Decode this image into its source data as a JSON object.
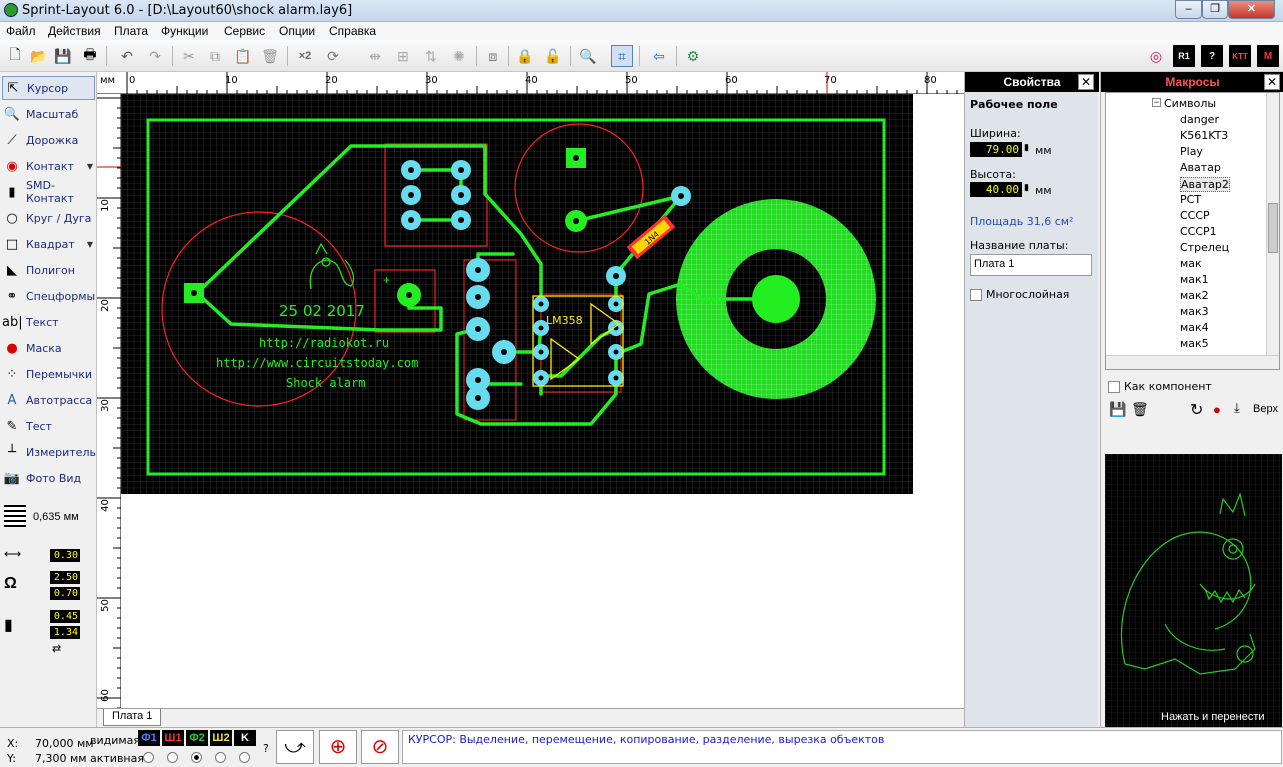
{
  "window": {
    "title": "Sprint-Layout 6.0 - [D:\\Layout60\\shock alarm.lay6]",
    "min": "–",
    "max": "❐",
    "close": "✕"
  },
  "menu": [
    "Файл",
    "Действия",
    "Плата",
    "Функции",
    "Сервис",
    "Опции",
    "Справка"
  ],
  "tools": [
    {
      "label": "Курсор",
      "icon": "cursor-icon",
      "glyph": "⇱"
    },
    {
      "label": "Масштаб",
      "icon": "zoom-icon",
      "glyph": "🔍"
    },
    {
      "label": "Дорожка",
      "icon": "track-icon",
      "glyph": "⟋"
    },
    {
      "label": "Контакт",
      "icon": "pad-icon",
      "glyph": "◉"
    },
    {
      "label": "SMD-Контакт",
      "icon": "smd-icon",
      "glyph": "▮"
    },
    {
      "label": "Круг / Дуга",
      "icon": "circle-icon",
      "glyph": "○"
    },
    {
      "label": "Квадрат",
      "icon": "square-icon",
      "glyph": "□"
    },
    {
      "label": "Полигон",
      "icon": "polygon-icon",
      "glyph": "◣"
    },
    {
      "label": "Спецформы",
      "icon": "special-shapes-icon",
      "glyph": "⚭"
    },
    {
      "label": "Текст",
      "icon": "text-icon",
      "glyph": "ab|"
    },
    {
      "label": "Маска",
      "icon": "mask-icon",
      "glyph": "●"
    },
    {
      "label": "Перемычки",
      "icon": "jumper-icon",
      "glyph": "⁘"
    },
    {
      "label": "Автотрасса",
      "icon": "autoroute-icon",
      "glyph": "A"
    },
    {
      "label": "Тест",
      "icon": "test-icon",
      "glyph": "✎"
    },
    {
      "label": "Измеритель",
      "icon": "measure-icon",
      "glyph": "┴"
    },
    {
      "label": "Фото Вид",
      "icon": "photo-view-icon",
      "glyph": "📷"
    }
  ],
  "grid": {
    "value": "0,635 мм"
  },
  "params": {
    "track_width": "0.30",
    "pad_outer": "2.50",
    "pad_inner": "0.70",
    "smd_w": "0.45",
    "smd_h": "1.34"
  },
  "ruler": {
    "unit": "мм",
    "top": [
      "0",
      "10",
      "20",
      "30",
      "40",
      "50",
      "60",
      "70",
      "80"
    ],
    "left": [
      "10",
      "20",
      "30",
      "40",
      "50",
      "60"
    ]
  },
  "board": {
    "date": "25 02 2017",
    "line1": "http://radiokot.ru",
    "line2": "http://www.circuitstoday.com",
    "line3": "Shock alarm",
    "ic": "LM358",
    "diode": "1N4"
  },
  "tab": "Плата 1",
  "properties": {
    "title": "Свойства",
    "section": "Рабочее поле",
    "width_label": "Ширина:",
    "width": "79.00",
    "unit": "мм",
    "height_label": "Высота:",
    "height": "40.00",
    "area": "Площадь   31,6 см²",
    "name_label": "Название платы:",
    "name": "Плата 1",
    "multilayer": "Многослойная"
  },
  "macros": {
    "title": "Макросы",
    "folder": "Символы",
    "items": [
      "danger",
      "K561KT3",
      "Play",
      "Аватар",
      "Аватар2",
      "PCT",
      "CCCP",
      "CCCP1",
      "Стрелец",
      "мак",
      "мак1",
      "мак2",
      "мак3",
      "мак4",
      "мак5"
    ],
    "selected": "Аватар2",
    "as_component": "Как компонент",
    "top_label": "Верх",
    "hint": "Нажать и перенести"
  },
  "status": {
    "x_label": "X:",
    "x": "70,000 мм",
    "y_label": "Y:",
    "y": "7,300 мм",
    "visible": "видимая",
    "active": "активная",
    "layers": [
      {
        "label": "Ф1",
        "color": "#4f7fff"
      },
      {
        "label": "Ш1",
        "color": "#ff3030"
      },
      {
        "label": "Ф2",
        "color": "#20d020"
      },
      {
        "label": "Ш2",
        "color": "#f0e030"
      },
      {
        "label": "K",
        "color": "#ffffff"
      }
    ],
    "help": "?",
    "message": "КУРСОР: Выделение, перемещение, копирование, разделение, вырезка объектов"
  }
}
